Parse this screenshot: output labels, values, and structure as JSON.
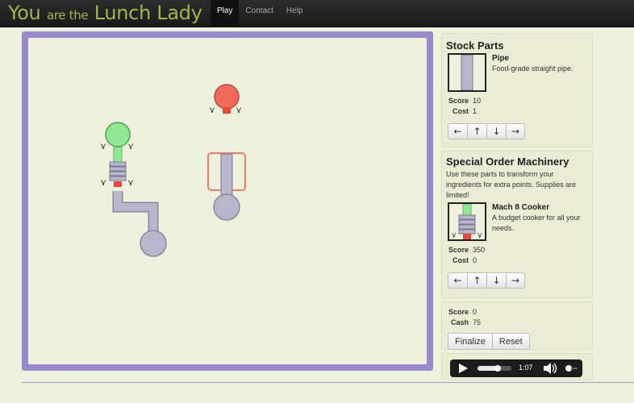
{
  "brand": {
    "part1": "You",
    "part2": "are the",
    "part3": "Lunch Lady"
  },
  "nav": [
    {
      "label": "Play",
      "active": true
    },
    {
      "label": "Contact"
    },
    {
      "label": "Help"
    }
  ],
  "stock_parts": {
    "title": "Stock Parts",
    "part": {
      "name": "Pipe",
      "description": "Food-grade straight pipe.",
      "score_label": "Score",
      "score": "10",
      "cost_label": "Cost",
      "cost": "1",
      "icon": "pipe-icon"
    },
    "arrows": [
      "←",
      "↑",
      "↓",
      "→"
    ]
  },
  "special_order": {
    "title": "Special Order Machinery",
    "description": "Use these parts to transform your ingredients for extra points. Supplies are limited!",
    "part": {
      "name": "Mach 8 Cooker",
      "description": "A budget cooker for all your needs.",
      "score_label": "Score",
      "score": "350",
      "cost_label": "Cost",
      "cost": "0",
      "icon": "cooker-icon"
    },
    "arrows": [
      "←",
      "↑",
      "↓",
      "→"
    ]
  },
  "totals": {
    "score_label": "Score",
    "score": "0",
    "cash_label": "Cash",
    "cash": "75"
  },
  "actions": {
    "finalize": "Finalize",
    "reset": "Reset"
  },
  "player": {
    "time": "1:07",
    "progress": 0.6
  },
  "colors": {
    "accent": "#9b8acb",
    "brand": "#9bb84a",
    "source": "#90e890",
    "target": "#f06a5a",
    "pipe": "#b8b6cc"
  }
}
